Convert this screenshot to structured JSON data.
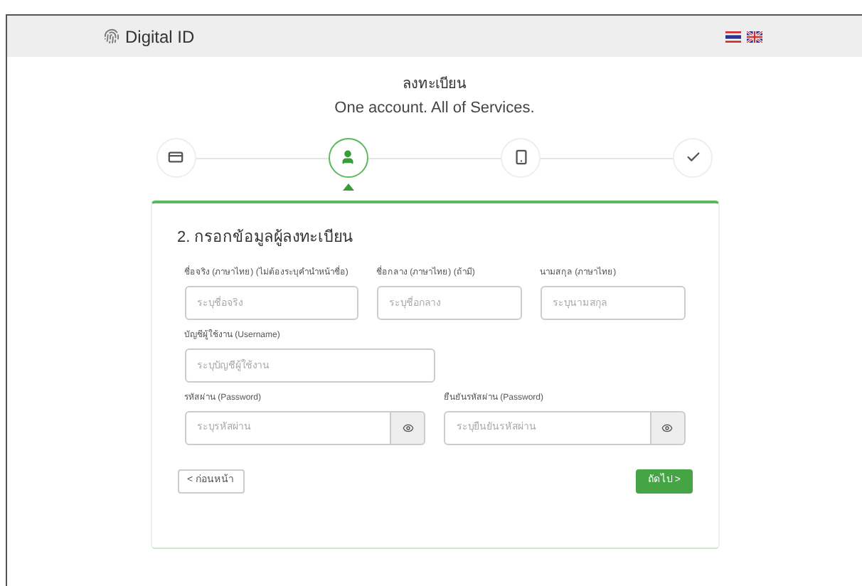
{
  "header": {
    "brand": "Digital ID",
    "languages": [
      {
        "kind": "thai"
      },
      {
        "kind": "uk"
      }
    ]
  },
  "heading": {
    "title": "ลงทะเบียน",
    "subtitle": "One account. All of Services."
  },
  "steps": [
    {
      "kind": "card",
      "selected": false
    },
    {
      "kind": "user",
      "selected": true
    },
    {
      "kind": "phone",
      "selected": false
    },
    {
      "kind": "check",
      "selected": false
    }
  ],
  "form": {
    "title": "2. กรอกข้อมูลผู้ลงทะเบียน",
    "rows": [
      [
        {
          "label": "ชื่อจริง (ภาษาไทย) (ไม่ต้องระบุคำนำหน้าชื่อ)",
          "placeholder": "ระบุชื่อจริง",
          "kind": "text"
        },
        {
          "label": "ชื่อกลาง (ภาษาไทย) (ถ้ามี)",
          "placeholder": "ระบุชื่อกลาง",
          "kind": "text"
        },
        {
          "label": "นามสกุล (ภาษาไทย)",
          "placeholder": "ระบุนามสกุล",
          "kind": "text"
        }
      ],
      [
        {
          "label": "บัญชีผู้ใช้งาน (Username)",
          "placeholder": "ระบุบัญชีผู้ใช้งาน",
          "kind": "text"
        }
      ],
      [
        {
          "label": "รหัสผ่าน (Password)",
          "placeholder": "ระบุรหัสผ่าน",
          "kind": "password"
        },
        {
          "label": "ยืนยันรหัสผ่าน (Password)",
          "placeholder": "ระบุยืนยันรหัสผ่าน",
          "kind": "password"
        }
      ]
    ],
    "back": "< ก่อนหน้า",
    "next": "ถัดไป >"
  }
}
